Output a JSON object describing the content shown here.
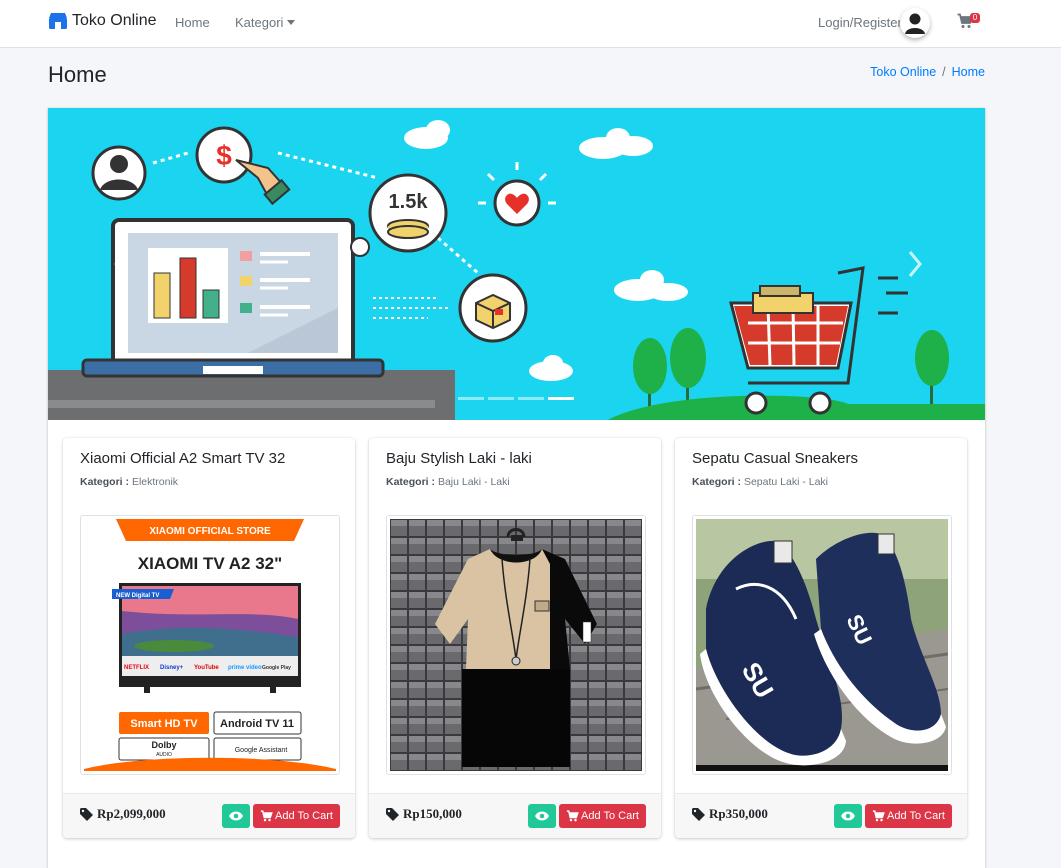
{
  "navbar": {
    "brand": "Toko Online",
    "home": "Home",
    "kategori": "Kategori",
    "login": "Login/Register",
    "cart_count": "0"
  },
  "header": {
    "title": "Home",
    "breadcrumb": [
      "Toko Online",
      "Home"
    ]
  },
  "banner": {
    "counter_text": "1.5k",
    "slides": 4,
    "active_slide": 4
  },
  "products": [
    {
      "name": "Xiaomi Official A2 Smart TV 32",
      "kategori_label": "Kategori :",
      "kategori": "Elektronik",
      "price": "Rp2,099,000",
      "cart_label": "Add To Cart",
      "img": {
        "store": "XIAOMI OFFICIAL STORE",
        "model": "XIAOMI TV A2 32\"",
        "tag": "NEW Digital TV",
        "apps": [
          "NETFLIX",
          "Disney+",
          "YouTube",
          "prime video",
          "Google Play"
        ],
        "feature1": "Smart HD TV",
        "feature2": "Android TV 11",
        "feature3": "Dolby",
        "feature3_sub": "AUDIO",
        "feature4": "Google Assistant"
      }
    },
    {
      "name": "Baju Stylish Laki - laki",
      "kategori_label": "Kategori :",
      "kategori": "Baju Laki - Laki",
      "price": "Rp150,000",
      "cart_label": "Add To Cart"
    },
    {
      "name": "Sepatu Casual Sneakers",
      "kategori_label": "Kategori :",
      "kategori": "Sepatu Laki - Laki",
      "price": "Rp350,000",
      "cart_label": "Add To Cart"
    }
  ],
  "colors": {
    "banner_bg": "#1ad4f0",
    "accent_red": "#dc3545",
    "accent_teal": "#20c997",
    "link": "#007bff"
  }
}
